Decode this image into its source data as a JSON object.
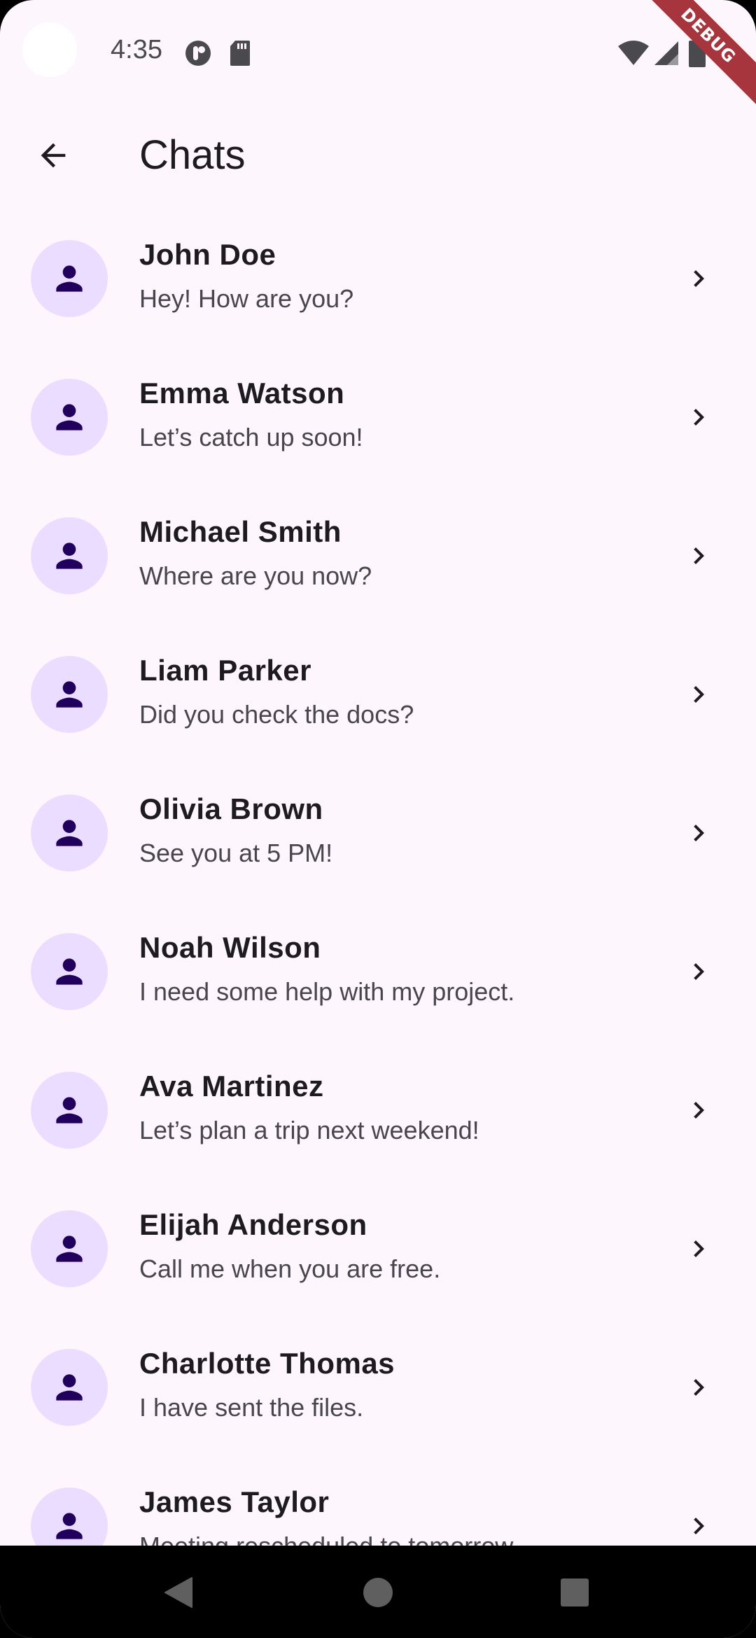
{
  "status_bar": {
    "time": "4:35",
    "icons": [
      "notification-app-icon",
      "sd-card-icon",
      "wifi-icon",
      "signal-icon",
      "battery-icon"
    ]
  },
  "debug_banner": "DEBUG",
  "app_bar": {
    "back_icon": "arrow-back-icon",
    "title": "Chats"
  },
  "chats": [
    {
      "name": "John Doe",
      "message": "Hey! How are you?"
    },
    {
      "name": "Emma Watson",
      "message": "Let’s catch up soon!"
    },
    {
      "name": "Michael Smith",
      "message": "Where are you now?"
    },
    {
      "name": "Liam Parker",
      "message": "Did you check the docs?"
    },
    {
      "name": "Olivia Brown",
      "message": "See you at 5 PM!"
    },
    {
      "name": "Noah Wilson",
      "message": "I need some help with my project."
    },
    {
      "name": "Ava Martinez",
      "message": "Let’s plan a trip next weekend!"
    },
    {
      "name": "Elijah Anderson",
      "message": "Call me when you are free."
    },
    {
      "name": "Charlotte Thomas",
      "message": "I have sent the files."
    },
    {
      "name": "James Taylor",
      "message": "Meeting rescheduled to tomorrow."
    }
  ],
  "colors": {
    "background": "#fdf7fd",
    "avatar_bg": "#ebddff",
    "avatar_icon": "#21005d",
    "name_text": "#1d1b20",
    "message_text": "#49454f",
    "debug_banner": "#a6353d"
  },
  "nav_bar": {
    "icons": [
      "nav-back-icon",
      "nav-home-icon",
      "nav-recents-icon"
    ]
  }
}
